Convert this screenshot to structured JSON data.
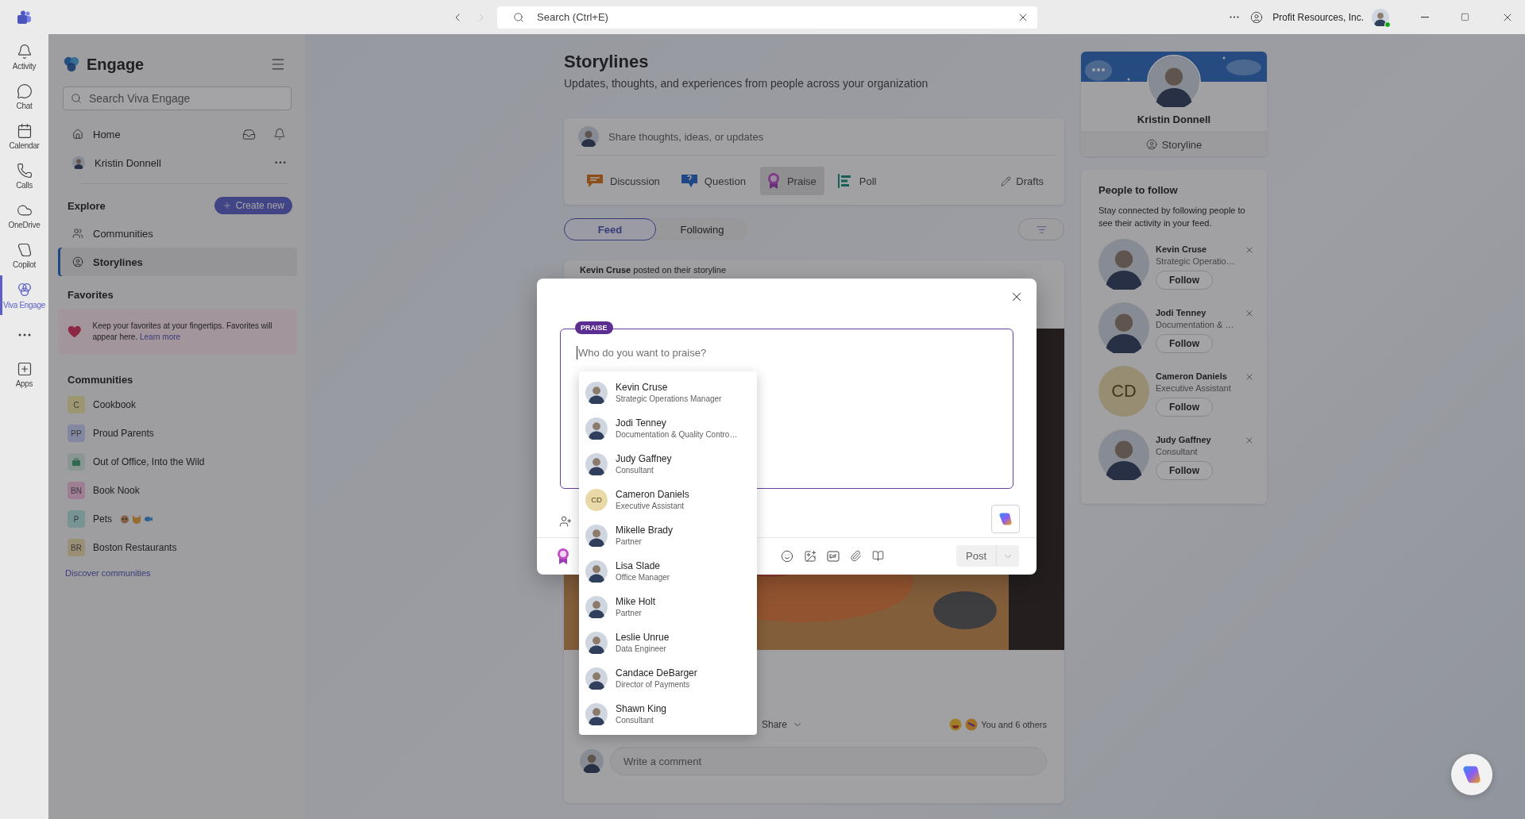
{
  "title_bar": {
    "search_placeholder": "Search (Ctrl+E)",
    "org": "Profit Resources, Inc."
  },
  "app_rail": [
    {
      "kind": "activity",
      "label": "Activity",
      "selected": false
    },
    {
      "kind": "chat",
      "label": "Chat",
      "selected": false
    },
    {
      "kind": "calendar",
      "label": "Calendar",
      "selected": false
    },
    {
      "kind": "calls",
      "label": "Calls",
      "selected": false
    },
    {
      "kind": "onedrive",
      "label": "OneDrive",
      "selected": false
    },
    {
      "kind": "copilot",
      "label": "Copilot",
      "selected": false
    },
    {
      "kind": "engage",
      "label": "Viva Engage",
      "selected": true
    },
    {
      "kind": "more",
      "selected": false
    },
    {
      "kind": "apps",
      "label": "Apps",
      "selected": false
    }
  ],
  "sidebar": {
    "app_name": "Engage",
    "search_placeholder": "Search Viva Engage",
    "nav": [
      {
        "kind": "home",
        "label": "Home"
      },
      {
        "kind": "profile",
        "label": "Kristin Donnell"
      }
    ],
    "explore": {
      "title": "Explore",
      "create_button": "Create new",
      "items": [
        {
          "kind": "communities",
          "label": "Communities",
          "selected": false
        },
        {
          "kind": "storylines",
          "label": "Storylines",
          "selected": true
        }
      ]
    },
    "favorites": {
      "title": "Favorites",
      "message": "Keep your favorites at your fingertips. Favorites will appear here.",
      "link": "Learn more"
    },
    "communities": {
      "title": "Communities",
      "items": [
        {
          "kind": "initials",
          "initials": "C",
          "name": "Cookbook",
          "color": "#9c9771"
        },
        {
          "kind": "initials",
          "initials": "PP",
          "name": "Proud Parents",
          "color": "#83879f"
        },
        {
          "kind": "icon",
          "name": "Out of Office, Into the Wild",
          "color": "#8a9692"
        },
        {
          "kind": "initials",
          "initials": "BN",
          "name": "Book Nook",
          "color": "#9d7e92"
        },
        {
          "kind": "initials",
          "initials": "P",
          "name": "Pets",
          "color": "#769592",
          "emojis": true
        },
        {
          "kind": "initials",
          "initials": "BR",
          "name": "Boston Restaurants",
          "color": "#998f74"
        }
      ],
      "discover": "Discover communities"
    }
  },
  "main": {
    "title": "Storylines",
    "subtitle": "Updates, thoughts, and experiences from people across your organization",
    "composer": {
      "placeholder": "Share thoughts, ideas, or updates",
      "post_types": [
        {
          "kind": "discussion",
          "label": "Discussion",
          "selected": false
        },
        {
          "kind": "question",
          "label": "Question",
          "selected": false
        },
        {
          "kind": "praise",
          "label": "Praise",
          "selected": true
        },
        {
          "kind": "poll",
          "label": "Poll",
          "selected": false
        }
      ],
      "drafts": "Drafts"
    },
    "feed_tabs": [
      {
        "label": "Feed",
        "selected": true
      },
      {
        "label": "Following",
        "selected": false
      }
    ],
    "post": {
      "header": "**Kevin Cruse** posted on their storyline",
      "share": "Share",
      "reactions": "You and 6 others",
      "comment_placeholder": "Write a comment"
    }
  },
  "profile": {
    "name": "Kristin Donnell",
    "storyline": "Storyline"
  },
  "people_to_follow": {
    "title": "People to follow",
    "description": "Stay connected by following people to see their activity in your feed.",
    "people": [
      {
        "name": "Kevin Cruse",
        "title": "Strategic Operatio…",
        "button": "Follow"
      },
      {
        "name": "Jodi Tenney",
        "title": "Documentation & …",
        "button": "Follow"
      },
      {
        "kind": "initials",
        "initials": "CD",
        "name": "Cameron Daniels",
        "title": "Executive Assistant",
        "button": "Follow"
      },
      {
        "name": "Judy Gaffney",
        "title": "Consultant",
        "button": "Follow"
      }
    ]
  },
  "praise_dialog": {
    "badge": "PRAISE",
    "placeholder": "Who do you want to praise?",
    "post_button": "Post",
    "suggestions": [
      {
        "name": "Kevin Cruse",
        "title": "Strategic Operations Manager"
      },
      {
        "name": "Jodi Tenney",
        "title": "Documentation & Quality Contro…"
      },
      {
        "name": "Judy Gaffney",
        "title": "Consultant"
      },
      {
        "kind": "initials",
        "initials": "CD",
        "name": "Cameron Daniels",
        "title": "Executive Assistant"
      },
      {
        "name": "Mikelle Brady",
        "title": "Partner"
      },
      {
        "name": "Lisa Slade",
        "title": "Office Manager"
      },
      {
        "name": "Mike Holt",
        "title": "Partner"
      },
      {
        "name": "Leslie Unrue",
        "title": "Data Engineer"
      },
      {
        "name": "Candace DeBarger",
        "title": "Director of Payments"
      },
      {
        "name": "Shawn King",
        "title": "Consultant"
      }
    ]
  }
}
